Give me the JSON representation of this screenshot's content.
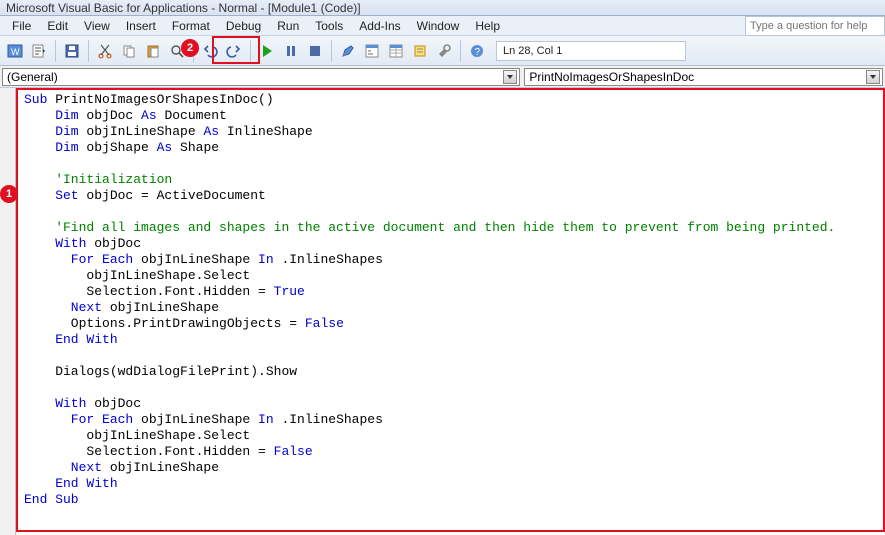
{
  "title": "Microsoft Visual Basic for Applications - Normal - [Module1 (Code)]",
  "menu": [
    "File",
    "Edit",
    "View",
    "Insert",
    "Format",
    "Debug",
    "Run",
    "Tools",
    "Add-Ins",
    "Window",
    "Help"
  ],
  "help_placeholder": "Type a question for help",
  "toolbar": {
    "status": "Ln 28, Col 1"
  },
  "callouts": {
    "one": "1",
    "two": "2"
  },
  "dropdown": {
    "left": "(General)",
    "right": "PrintNoImagesOrShapesInDoc"
  },
  "code": {
    "l1a": "Sub",
    "l1b": " PrintNoImagesOrShapesInDoc()",
    "l2a": "    Dim",
    "l2b": " objDoc ",
    "l2c": "As",
    "l2d": " Document",
    "l3a": "    Dim",
    "l3b": " objInLineShape ",
    "l3c": "As",
    "l3d": " InlineShape",
    "l4a": "    Dim",
    "l4b": " objShape ",
    "l4c": "As",
    "l4d": " Shape",
    "l5": "",
    "l6": "    'Initialization",
    "l7a": "    Set",
    "l7b": " objDoc = ActiveDocument",
    "l8": "",
    "l9": "    'Find all images and shapes in the active document and then hide them to prevent from being printed.",
    "l10a": "    With",
    "l10b": " objDoc",
    "l11a": "      For Each",
    "l11b": " objInLineShape ",
    "l11c": "In",
    "l11d": " .InlineShapes",
    "l12": "        objInLineShape.Select",
    "l13a": "        Selection.Font.Hidden = ",
    "l13b": "True",
    "l14a": "      Next",
    "l14b": " objInLineShape",
    "l15a": "      Options.PrintDrawingObjects = ",
    "l15b": "False",
    "l16": "    End With",
    "l17": "",
    "l18": "    Dialogs(wdDialogFilePrint).Show",
    "l19": "",
    "l20a": "    With",
    "l20b": " objDoc",
    "l21a": "      For Each",
    "l21b": " objInLineShape ",
    "l21c": "In",
    "l21d": " .InlineShapes",
    "l22": "        objInLineShape.Select",
    "l23a": "        Selection.Font.Hidden = ",
    "l23b": "False",
    "l24a": "      Next",
    "l24b": " objInLineShape",
    "l25": "    End With",
    "l26": "End Sub"
  }
}
